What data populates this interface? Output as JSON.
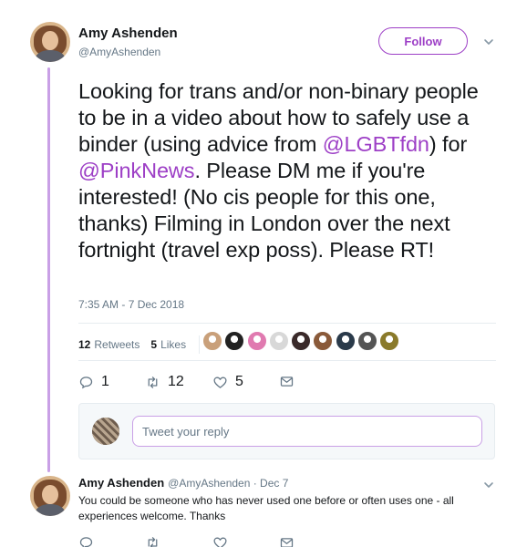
{
  "tweet": {
    "author_name": "Amy Ashenden",
    "author_handle": "@AmyAshenden",
    "follow_label": "Follow",
    "text_segments": {
      "t1": "Looking for trans and/or non-binary people to be in a video about how to safely use a binder (using advice from ",
      "m1": "@LGBTfdn",
      "t2": ") for ",
      "m2": "@PinkNews",
      "t3": ". Please DM me if you're interested! (No cis people for this one, thanks) Filming in London over the next fortnight (travel exp poss). Please RT!"
    },
    "timestamp": "7:35 AM - 7 Dec 2018",
    "retweets_count": "12",
    "retweets_label": "Retweets",
    "likes_count": "5",
    "likes_label": "Likes",
    "liker_avatars": [
      {
        "icon": "liker-avatar-1",
        "color": "#c9a07a"
      },
      {
        "icon": "liker-avatar-2",
        "color": "#222222"
      },
      {
        "icon": "liker-avatar-3",
        "color": "#e07ab0"
      },
      {
        "icon": "liker-avatar-4",
        "color": "#d8d8d8"
      },
      {
        "icon": "liker-avatar-5",
        "color": "#3a2a2a"
      },
      {
        "icon": "liker-avatar-6",
        "color": "#8a5a3a"
      },
      {
        "icon": "liker-avatar-7",
        "color": "#2a3a4a"
      },
      {
        "icon": "liker-avatar-8",
        "color": "#555555"
      },
      {
        "icon": "liker-avatar-9",
        "color": "#8a7a2a"
      }
    ],
    "actions": {
      "reply_count": "1",
      "retweet_count": "12",
      "like_count": "5"
    }
  },
  "reply_box": {
    "placeholder": "Tweet your reply"
  },
  "reply": {
    "author_name": "Amy Ashenden",
    "meta": "@AmyAshenden · Dec 7",
    "text": "You could be someone who has never used one before or often uses one - all experiences welcome. Thanks"
  },
  "colors": {
    "accent": "#9d3fc6",
    "thread_line": "#c9a0e6",
    "muted": "#657786"
  }
}
